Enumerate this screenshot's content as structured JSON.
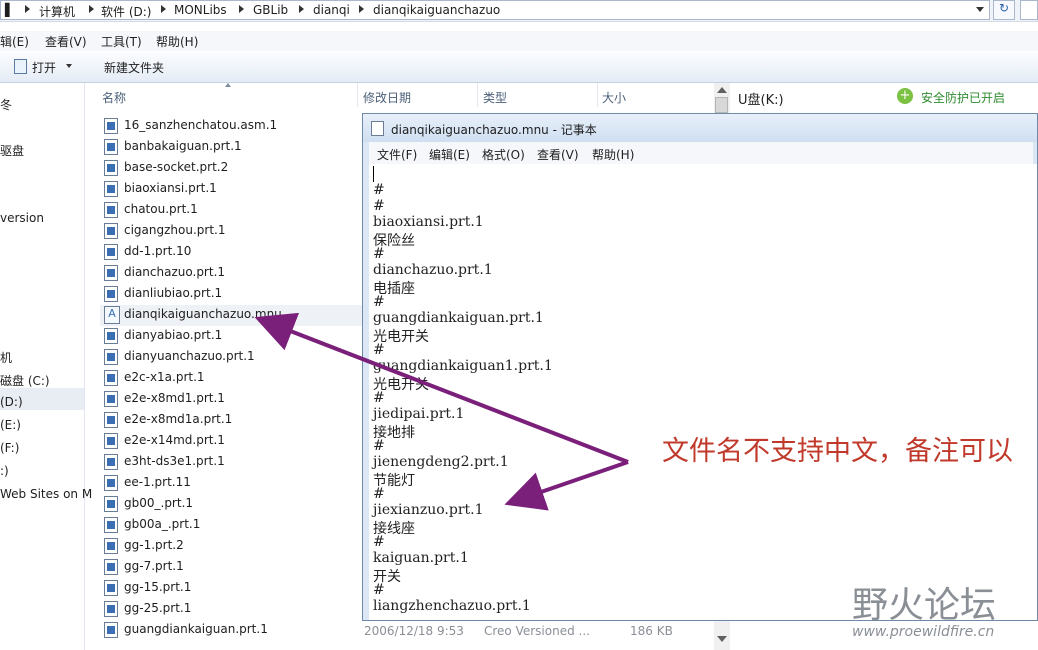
{
  "address": {
    "crumbs": [
      "计算机",
      "软件 (D:)",
      "MONLibs",
      "GBLib",
      "dianqi",
      "dianqikaiguanchazuo"
    ]
  },
  "explorer_menu": [
    "辑(E)",
    "查看(V)",
    "工具(T)",
    "帮助(H)"
  ],
  "toolbar": {
    "open_label": "打开",
    "new_folder_label": "新建文件夹"
  },
  "nav_items": [
    "冬",
    "驱盘",
    "version",
    "机",
    "磁盘 (C:)",
    "(D:)",
    "(E:)",
    "(F:)",
    ":)",
    "Web Sites on M"
  ],
  "columns": {
    "name": "名称",
    "date": "修改日期",
    "type": "类型",
    "size": "大小"
  },
  "files": [
    "16_sanzhenchatou.asm.1",
    "banbakaiguan.prt.1",
    "base-socket.prt.2",
    "biaoxiansi.prt.1",
    "chatou.prt.1",
    "cigangzhou.prt.1",
    "dd-1.prt.10",
    "dianchazuo.prt.1",
    "dianliubiao.prt.1",
    "dianqikaiguanchazuo.mnu",
    "dianyabiao.prt.1",
    "dianyuanchazuo.prt.1",
    "e2c-x1a.prt.1",
    "e2e-x8md1.prt.1",
    "e2e-x8md1a.prt.1",
    "e2e-x14md.prt.1",
    "e3ht-ds3e1.prt.1",
    "ee-1.prt.11",
    "gb00_.prt.1",
    "gb00a_.prt.1",
    "gg-1.prt.2",
    "gg-7.prt.1",
    "gg-15.prt.1",
    "gg-25.prt.1",
    "guangdiankaiguan.prt.1"
  ],
  "last_row": {
    "date": "2006/12/18 9:53",
    "type": "Creo Versioned ...",
    "size": "186 KB"
  },
  "right_pane": {
    "drive": "U盘(K:)",
    "security": "安全防护已开启"
  },
  "notepad": {
    "title": "dianqikaiguanchazuo.mnu - 记事本",
    "menu": [
      "文件(F)",
      "编辑(E)",
      "格式(O)",
      "查看(V)",
      "帮助(H)"
    ],
    "lines": [
      "#",
      "#",
      "biaoxiansi.prt.1",
      "保险丝",
      "#",
      "dianchazuo.prt.1",
      "电插座",
      "#",
      "guangdiankaiguan.prt.1",
      "光电开关",
      "#",
      "guangdiankaiguan1.prt.1",
      "光电开关",
      "#",
      "jiedipai.prt.1",
      "接地排",
      "#",
      "jienengdeng2.prt.1",
      "节能灯",
      "#",
      "jiexianzuo.prt.1",
      "接线座",
      "#",
      "kaiguan.prt.1",
      "开关",
      "#",
      "liangzhenchazuo.prt.1"
    ]
  },
  "annotation": {
    "text": "文件名不支持中文，备注可以",
    "color": "#c0392b"
  },
  "arrow_color": "#7a1f7a",
  "watermark": {
    "text": "野火论坛",
    "url": "www.proewildfire.cn"
  }
}
